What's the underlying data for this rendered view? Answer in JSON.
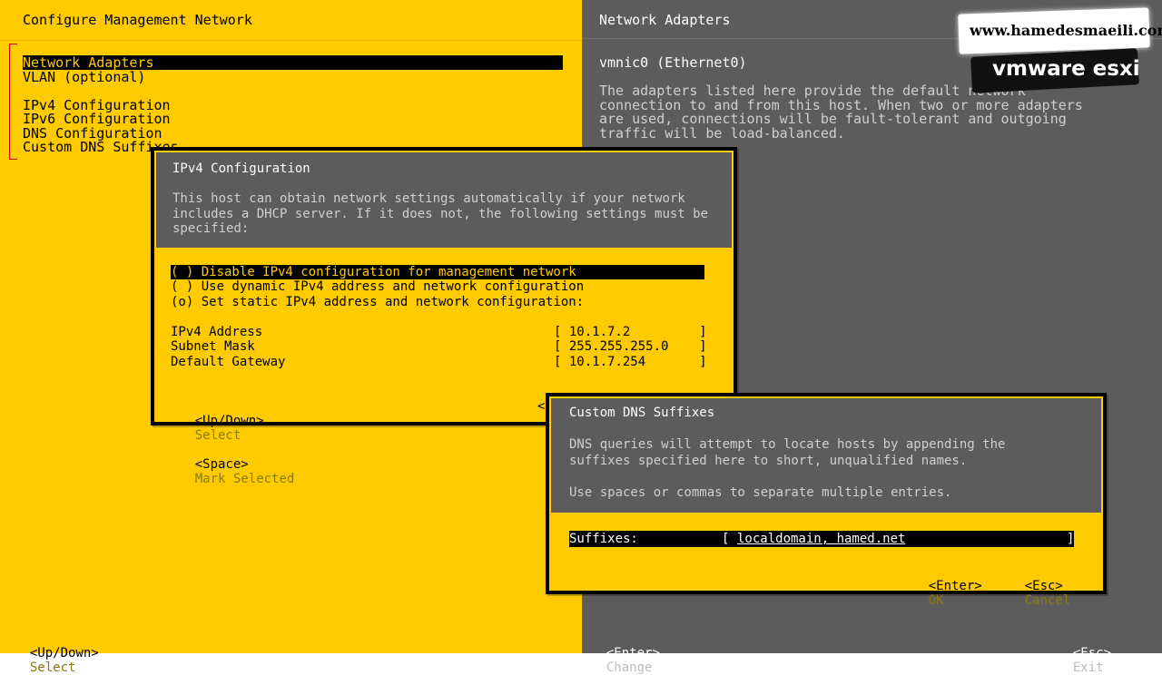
{
  "left_panel": {
    "title": "Configure Management Network",
    "menu": [
      "Network Adapters",
      "VLAN (optional)",
      "",
      "IPv4 Configuration",
      "IPv6 Configuration",
      "DNS Configuration",
      "Custom DNS Suffixes"
    ],
    "footer_key": "<Up/Down>",
    "footer_action": "Select"
  },
  "right_panel": {
    "title": "Network Adapters",
    "adapter": "vmnic0 (Ethernet0)",
    "description": [
      "The adapters listed here provide the default network",
      "connection to and from this host. When two or more adapters",
      "are used, connections will be fault-tolerant and outgoing",
      "traffic will be load-balanced."
    ],
    "footer_enter_key": "<Enter>",
    "footer_enter_action": "Change",
    "footer_esc_key": "<Esc>",
    "footer_esc_action": "Exit"
  },
  "watermark": {
    "site": "www.hamedesmaeili.com",
    "label": "vmware esxi"
  },
  "ipv4_dialog": {
    "title": "IPv4 Configuration",
    "description": [
      "This host can obtain network settings automatically if your network",
      "includes a DHCP server. If it does not, the following settings must be",
      "specified:"
    ],
    "options": [
      "( ) Disable IPv4 configuration for management network",
      "( ) Use dynamic IPv4 address and network configuration",
      "(o) Set static IPv4 address and network configuration:"
    ],
    "fields": [
      {
        "label": "IPv4 Address",
        "value": "[ 10.1.7.2         ]"
      },
      {
        "label": "Subnet Mask",
        "value": "[ 255.255.255.0    ]"
      },
      {
        "label": "Default Gateway",
        "value": "[ 10.1.7.254       ]"
      }
    ],
    "footer_key1": "<Up/Down>",
    "footer_action1": "Select",
    "footer_key2": "<Space>",
    "footer_action2": "Mark Selected",
    "footer_partial": "<"
  },
  "dns_dialog": {
    "title": "Custom DNS Suffixes",
    "description": [
      "DNS queries will attempt to locate hosts by appending the",
      "suffixes specified here to short, unqualified names."
    ],
    "hint": "Use spaces or commas to separate multiple entries.",
    "field_label": "Suffixes:",
    "field_open": "[",
    "field_value": "localdomain, hamed.net",
    "field_close": "]",
    "ok_key": "<Enter>",
    "ok_action": "OK",
    "cancel_key": "<Esc>",
    "cancel_action": "Cancel"
  }
}
